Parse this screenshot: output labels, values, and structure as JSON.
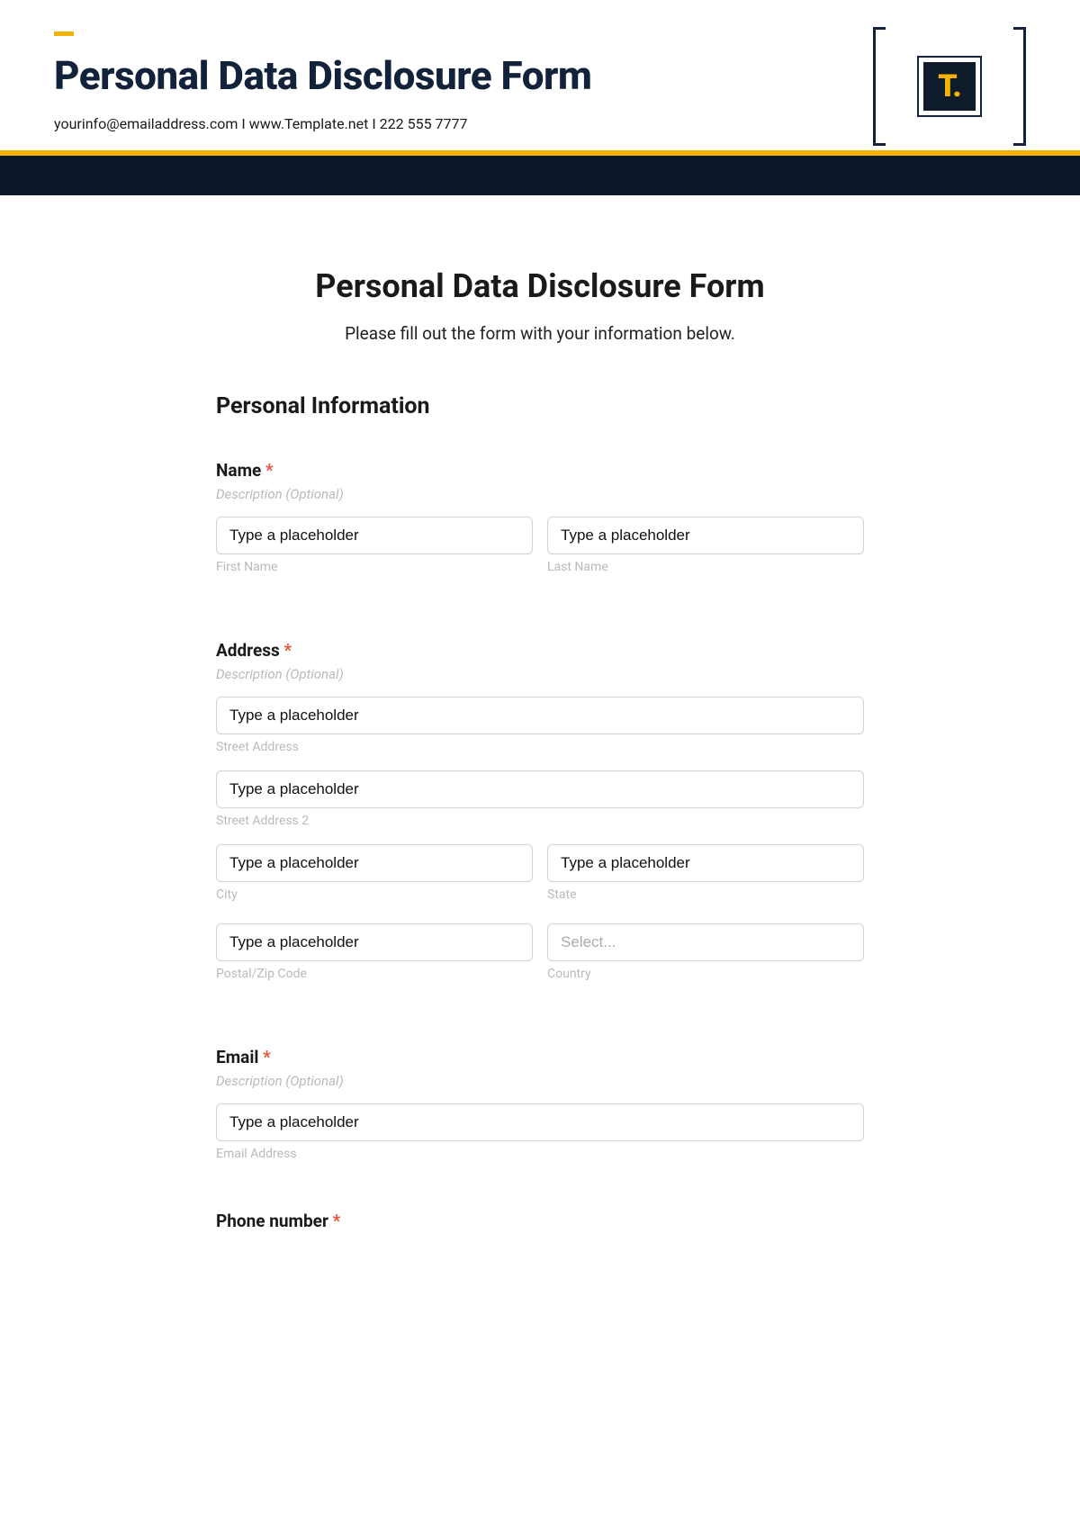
{
  "banner": {
    "title": "Personal Data Disclosure Form",
    "email": "yourinfo@emailaddress.com",
    "sep": "  I  ",
    "website": "www.Template.net",
    "phone": "222 555 7777",
    "logo_text": "T."
  },
  "form": {
    "title": "Personal Data Disclosure Form",
    "subtitle": "Please fill out the form with your information below.",
    "section1": "Personal Information",
    "name": {
      "label": "Name",
      "req": "*",
      "desc": "Description (Optional)",
      "first_ph": "Type a placeholder",
      "first_sub": "First Name",
      "last_ph": "Type a placeholder",
      "last_sub": "Last Name"
    },
    "address": {
      "label": "Address",
      "req": "*",
      "desc": "Description (Optional)",
      "street_ph": "Type a placeholder",
      "street_sub": "Street Address",
      "street2_ph": "Type a placeholder",
      "street2_sub": "Street Address 2",
      "city_ph": "Type a placeholder",
      "city_sub": "City",
      "state_ph": "Type a placeholder",
      "state_sub": "State",
      "postal_ph": "Type a placeholder",
      "postal_sub": "Postal/Zip Code",
      "country_ph": "Select...",
      "country_sub": "Country"
    },
    "email": {
      "label": "Email",
      "req": "*",
      "desc": "Description (Optional)",
      "ph": "Type a placeholder",
      "sub": "Email Address"
    },
    "phone": {
      "label": "Phone number",
      "req": "*"
    }
  }
}
